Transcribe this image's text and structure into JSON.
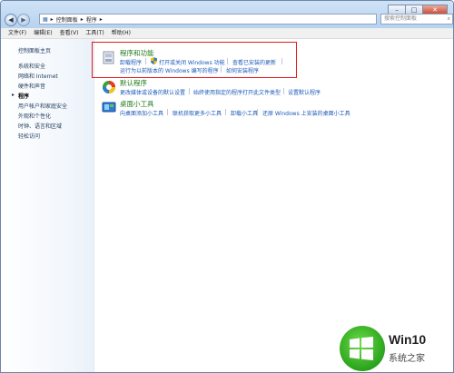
{
  "breadcrumb": {
    "part1": "控制面板",
    "part2": "程序"
  },
  "search": {
    "placeholder": "搜索控制面板"
  },
  "menu": {
    "file": "文件(F)",
    "edit": "编辑(E)",
    "view": "查看(V)",
    "tools": "工具(T)",
    "help": "帮助(H)"
  },
  "sidebar": {
    "home": "控制面板主页",
    "items": [
      "系统和安全",
      "网络和 Internet",
      "硬件和声音",
      "程序",
      "用户帐户和家庭安全",
      "外观和个性化",
      "时钟、语言和区域",
      "轻松访问"
    ]
  },
  "categories": {
    "programs": {
      "title": "程序和功能",
      "links": [
        "卸载程序",
        "打开或关闭 Windows 功能",
        "查看已安装的更新",
        "运行为以前版本的 Windows 编写的程序",
        "如何安装程序"
      ]
    },
    "defaults": {
      "title": "默认程序",
      "links": [
        "更改媒体或设备的默认设置",
        "始终使用指定的程序打开此文件类型",
        "设置默认程序"
      ]
    },
    "gadgets": {
      "title": "桌面小工具",
      "links": [
        "向桌面添加小工具",
        "联机获取更多小工具",
        "卸载小工具",
        "还原 Windows 上安装的桌面小工具"
      ]
    }
  },
  "watermark": {
    "brand": "Win10",
    "site": "系统之家"
  }
}
